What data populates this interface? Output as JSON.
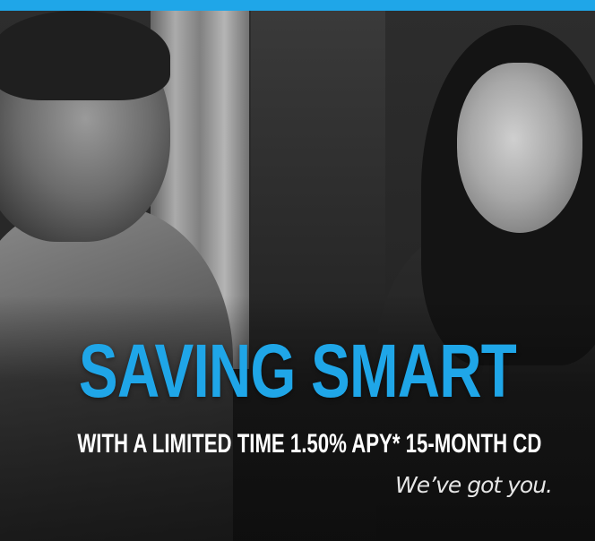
{
  "colors": {
    "accent": "#1fa6e8",
    "text_light": "#ffffff"
  },
  "ad": {
    "headline": "SAVING SMART",
    "subheadline": "WITH A LIMITED TIME 1.50% APY* 15-MONTH CD",
    "tagline": "We’ve got you."
  }
}
